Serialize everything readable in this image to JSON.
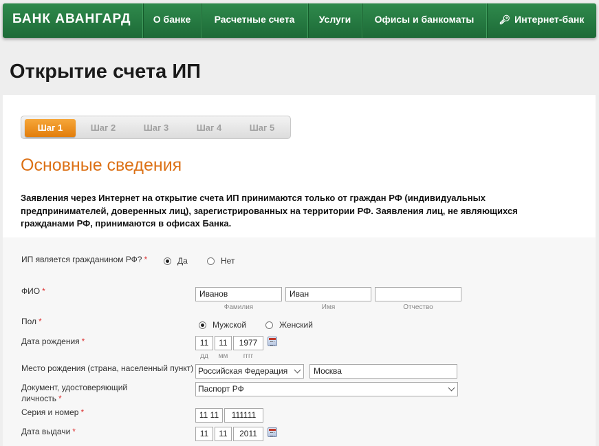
{
  "nav": {
    "logo": "БАНК АВАНГАРД",
    "items": [
      "О банке",
      "Расчетные счета",
      "Услуги",
      "Офисы и банкоматы",
      "Интернет-банк"
    ],
    "key_icon": "key-icon"
  },
  "page_title": "Открытие счета ИП",
  "steps": [
    "Шаг 1",
    "Шаг 2",
    "Шаг 3",
    "Шаг 4",
    "Шаг 5"
  ],
  "active_step": "Шаг 1",
  "section_title": "Основные сведения",
  "notice_lines": [
    "Заявления через Интернет на открытие счета ИП принимаются только от граждан РФ (индивидуальных",
    "предпринимателей, доверенных лиц), зарегистрированных на территории РФ. Заявления лиц, не являющихся",
    "гражданами РФ, принимаются в офисах Банка."
  ],
  "required_mark": "*",
  "form": {
    "citizen": {
      "label": "ИП является гражданином РФ?",
      "yes": "Да",
      "no": "Нет",
      "selected": "Да"
    },
    "fio": {
      "label": "ФИО",
      "last_name": "Иванов",
      "first_name": "Иван",
      "patronymic": "",
      "last_name_hint": "Фамилия",
      "first_name_hint": "Имя",
      "patronymic_hint": "Отчество"
    },
    "gender": {
      "label": "Пол",
      "male": "Мужской",
      "female": "Женский",
      "selected": "Мужской"
    },
    "birth_date": {
      "label": "Дата рождения",
      "day": "11",
      "month": "11",
      "year": "1977",
      "day_hint": "дд",
      "month_hint": "мм",
      "year_hint": "гггг"
    },
    "birth_place": {
      "label": "Место рождения (страна, населенный пункт)",
      "country": "Российская Федерация",
      "city": "Москва"
    },
    "document": {
      "label_line1": "Документ, удостоверяющий",
      "label_line2": "личность",
      "value": "Паспорт РФ"
    },
    "series_number": {
      "label": "Серия и номер",
      "series": "11 11",
      "number": "111111"
    },
    "issue_date": {
      "label": "Дата выдачи",
      "day": "11",
      "month": "11",
      "year": "2011"
    }
  }
}
